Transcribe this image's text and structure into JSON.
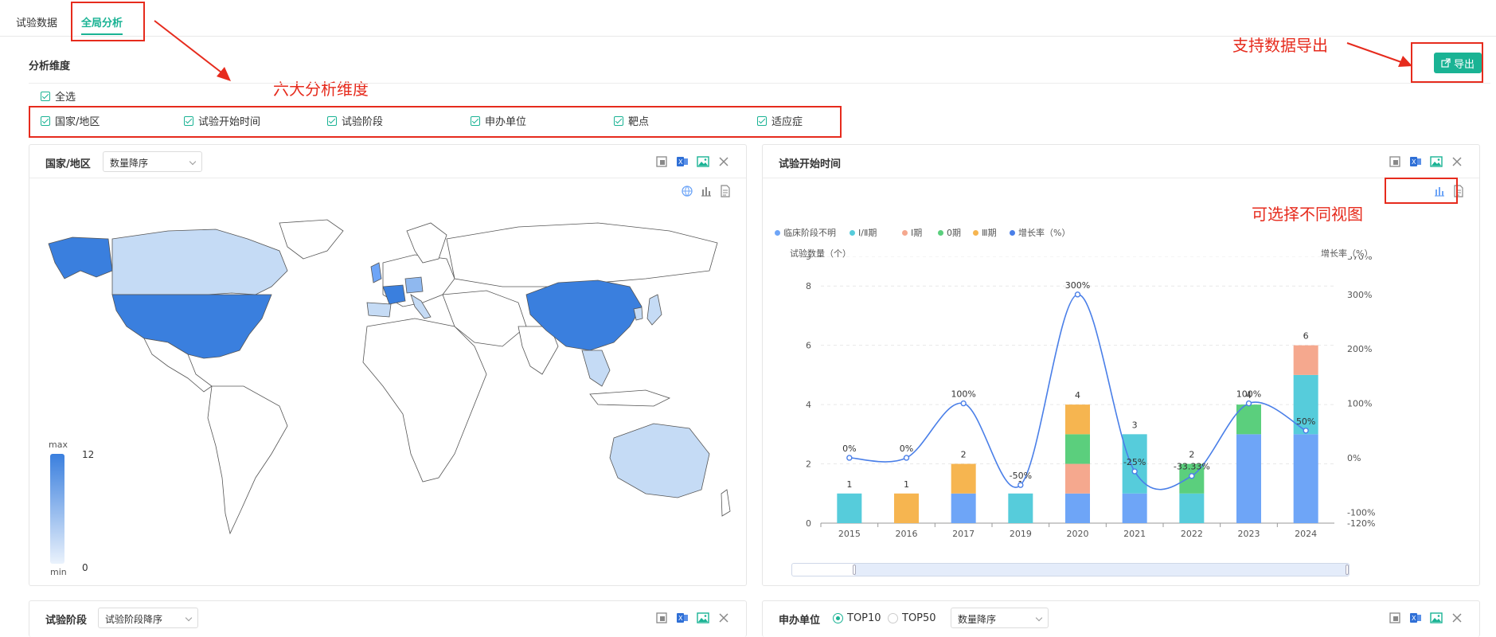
{
  "tabs": [
    {
      "label": "试验数据",
      "active": false
    },
    {
      "label": "全局分析",
      "active": true
    }
  ],
  "section_title": "分析维度",
  "export_label": "导出",
  "annotations": {
    "dimensions": "六大分析维度",
    "export": "支持数据导出",
    "views": "可选择不同视图"
  },
  "select_all": "全选",
  "dimensions": [
    "国家/地区",
    "试验开始时间",
    "试验阶段",
    "申办单位",
    "靶点",
    "适应症"
  ],
  "panel_country": {
    "title": "国家/地区",
    "sort_select": "数量降序",
    "scale": {
      "max_label": "max",
      "min_label": "min",
      "max_value": "12",
      "min_value": "0"
    }
  },
  "panel_time": {
    "title": "试验开始时间"
  },
  "panel_phase": {
    "title": "试验阶段",
    "sort_select": "试验阶段降序"
  },
  "panel_sponsor": {
    "title": "申办单位",
    "radio_top10": "TOP10",
    "radio_top50": "TOP50",
    "sort_select": "数量降序"
  },
  "colors": {
    "accent": "#1ab394",
    "annotation": "#e62b1d",
    "map_max": "#3a7fde",
    "map_min": "#d9e7f8"
  },
  "chart_data": {
    "type": "bar",
    "categories": [
      "2015",
      "2016",
      "2017",
      "2019",
      "2020",
      "2021",
      "2022",
      "2023",
      "2024"
    ],
    "series": [
      {
        "name": "临床阶段不明",
        "color": "#6ea5f7",
        "values": [
          0,
          0,
          1,
          0,
          1,
          1,
          0,
          3,
          3
        ]
      },
      {
        "name": "Ⅰ/Ⅱ期",
        "color": "#56ccdb",
        "values": [
          1,
          0,
          0,
          1,
          0,
          2,
          1,
          0,
          2
        ]
      },
      {
        "name": "Ⅰ期",
        "color": "#f5a88e",
        "values": [
          0,
          0,
          0,
          0,
          1,
          0,
          0,
          0,
          1
        ]
      },
      {
        "name": "0期",
        "color": "#5bcf7d",
        "values": [
          0,
          0,
          0,
          0,
          1,
          0,
          1,
          1,
          0
        ]
      },
      {
        "name": "Ⅲ期",
        "color": "#f6b550",
        "values": [
          0,
          1,
          1,
          0,
          1,
          0,
          0,
          0,
          0
        ]
      }
    ],
    "totals": [
      1,
      1,
      2,
      1,
      4,
      3,
      2,
      4,
      6
    ],
    "growth": {
      "name": "增长率（%）",
      "color": "#4a7fe8",
      "values": [
        0,
        0,
        100,
        -50,
        300,
        -25,
        -33.33
      ],
      "labels": [
        "0%",
        "0%",
        "100%",
        "-50%",
        "300%",
        "-25%",
        "-33.33%",
        "100%",
        "50%"
      ],
      "full_values": [
        0,
        0,
        100,
        -50,
        300,
        -25,
        -33.33,
        100,
        50
      ]
    },
    "ylabel_left": "试验数量（个）",
    "ylabel_right": "增长率（%）",
    "ylim_left": [
      0,
      9
    ],
    "yticks_left": [
      "0",
      "2",
      "4",
      "6",
      "8",
      "9"
    ],
    "ylim_right": [
      -120,
      370
    ],
    "yticks_right": [
      "-120%",
      "-100%",
      "0%",
      "100%",
      "200%",
      "300%",
      "370%"
    ],
    "grid": true,
    "legend": "top-left"
  }
}
